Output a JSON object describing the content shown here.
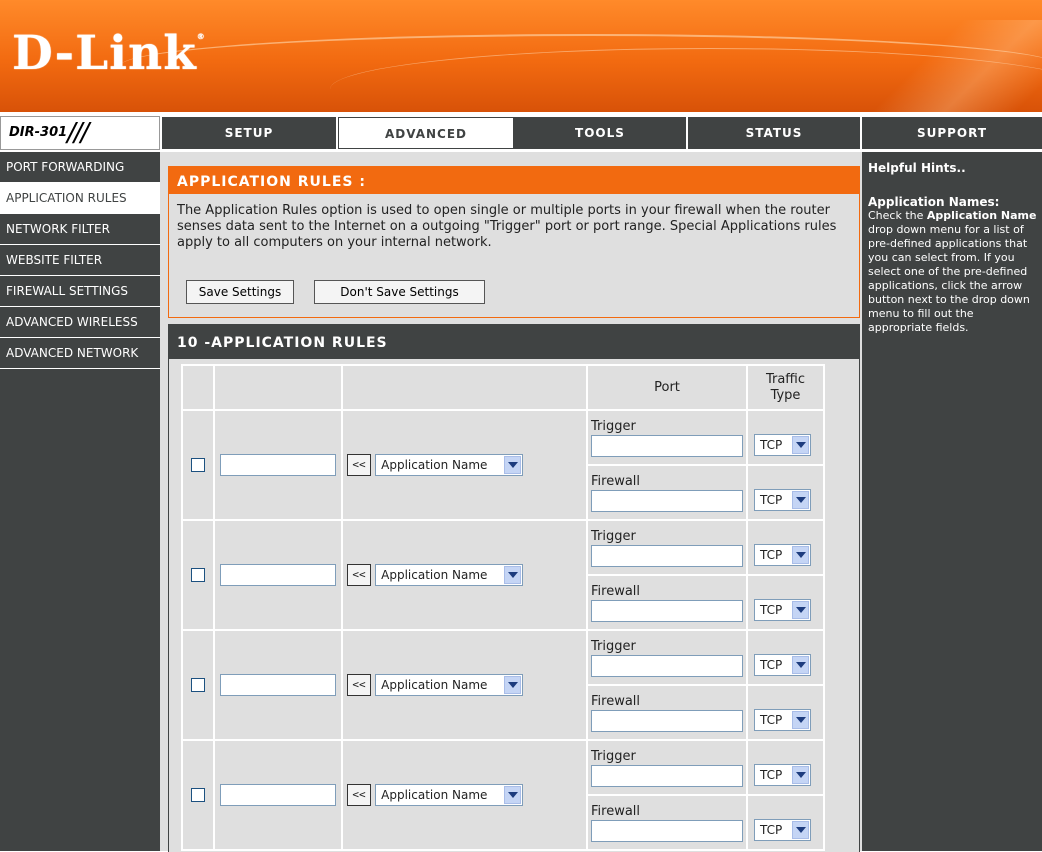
{
  "brand": {
    "logo_text": "D-Link",
    "registered_mark": "®",
    "model": "DIR-301",
    "model_slashes": "///"
  },
  "nav": {
    "tabs": [
      {
        "label": "SETUP"
      },
      {
        "label": "ADVANCED",
        "active": true
      },
      {
        "label": "TOOLS"
      },
      {
        "label": "STATUS"
      },
      {
        "label": "SUPPORT"
      }
    ]
  },
  "sidebar": {
    "items": [
      {
        "label": "PORT FORWARDING"
      },
      {
        "label": "APPLICATION RULES",
        "active": true
      },
      {
        "label": "NETWORK FILTER"
      },
      {
        "label": "WEBSITE FILTER"
      },
      {
        "label": "FIREWALL SETTINGS"
      },
      {
        "label": "ADVANCED WIRELESS"
      },
      {
        "label": "ADVANCED NETWORK"
      }
    ]
  },
  "application_rules": {
    "title": "APPLICATION RULES :",
    "description": "The Application Rules option is used to open single or multiple ports in your firewall when the router senses data sent to the Internet on a outgoing \"Trigger\" port or port range. Special Applications rules apply to all computers on your internal network.",
    "save_label": "Save Settings",
    "dont_save_label": "Don't Save Settings"
  },
  "rules_table": {
    "title": "10 -APPLICATION RULES",
    "col_port": "Port",
    "col_traffic_line1": "Traffic",
    "col_traffic_line2": "Type",
    "arrow_label": "<<",
    "trigger_label": "Trigger",
    "firewall_label": "Firewall",
    "app_select_value": "Application Name",
    "protocol_value": "TCP",
    "rows": [
      {
        "enabled": false,
        "name": "",
        "trigger_port": "",
        "trigger_type": "TCP",
        "firewall_port": "",
        "firewall_type": "TCP"
      },
      {
        "enabled": false,
        "name": "",
        "trigger_port": "",
        "trigger_type": "TCP",
        "firewall_port": "",
        "firewall_type": "TCP"
      },
      {
        "enabled": false,
        "name": "",
        "trigger_port": "",
        "trigger_type": "TCP",
        "firewall_port": "",
        "firewall_type": "TCP"
      },
      {
        "enabled": false,
        "name": "",
        "trigger_port": "",
        "trigger_type": "TCP",
        "firewall_port": "",
        "firewall_type": "TCP"
      }
    ]
  },
  "hints": {
    "title": "Helpful Hints..",
    "heading": "Application Names:",
    "text_1": "Check the ",
    "bold_1": "Application Name",
    "text_2": " drop down menu for a list of pre-defined applications that you can select from. If you select one of the pre-defined applications, click the arrow button next to the drop down menu to fill out the appropriate fields."
  },
  "colors": {
    "accent_orange": "#f26a10",
    "dark_gray": "#404343",
    "panel_gray": "#dfdfdf"
  }
}
